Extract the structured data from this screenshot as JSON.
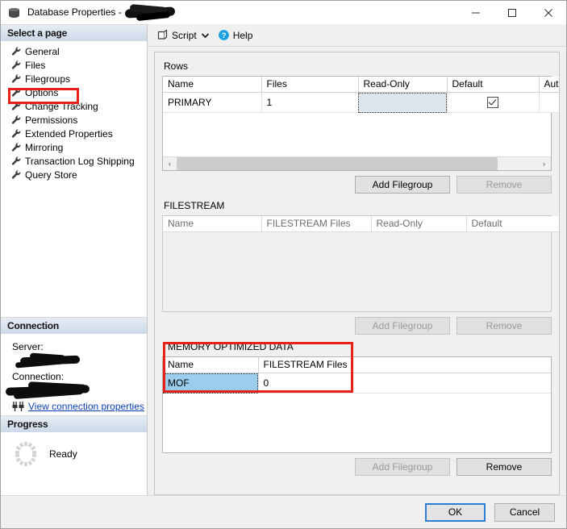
{
  "window": {
    "title_prefix": "Database Properties -",
    "icon": "database-icon",
    "redacted_title": "",
    "controls": {
      "minimize": "—",
      "maximize": "□",
      "close": "✕"
    }
  },
  "sidebar": {
    "select_page_header": "Select a page",
    "items": [
      {
        "label": "General",
        "icon": "wrench-icon",
        "selected": false
      },
      {
        "label": "Files",
        "icon": "wrench-icon",
        "selected": false
      },
      {
        "label": "Filegroups",
        "icon": "wrench-icon",
        "selected": true
      },
      {
        "label": "Options",
        "icon": "wrench-icon",
        "selected": false
      },
      {
        "label": "Change Tracking",
        "icon": "wrench-icon",
        "selected": false
      },
      {
        "label": "Permissions",
        "icon": "wrench-icon",
        "selected": false
      },
      {
        "label": "Extended Properties",
        "icon": "wrench-icon",
        "selected": false
      },
      {
        "label": "Mirroring",
        "icon": "wrench-icon",
        "selected": false
      },
      {
        "label": "Transaction Log Shipping",
        "icon": "wrench-icon",
        "selected": false
      },
      {
        "label": "Query Store",
        "icon": "wrench-icon",
        "selected": false
      }
    ],
    "connection": {
      "header": "Connection",
      "server_label": "Server:",
      "server_value": "",
      "connection_label": "Connection:",
      "connection_value": "",
      "view_properties_link": "View connection properties",
      "link_icon": "connection-plug-icon"
    },
    "progress": {
      "header": "Progress",
      "status": "Ready",
      "spinner_icon": "progress-spinner-icon"
    }
  },
  "toolbar": {
    "script_label": "Script",
    "script_icon": "script-icon",
    "dropdown_icon": "chevron-down-icon",
    "help_label": "Help",
    "help_icon": "help-question-icon"
  },
  "main": {
    "rows_section": {
      "label": "Rows",
      "columns": [
        "Name",
        "Files",
        "Read-Only",
        "Default",
        "Autog"
      ],
      "rows": [
        {
          "name": "PRIMARY",
          "files": "1",
          "read_only": "",
          "default_checked": true,
          "autogrow": ""
        }
      ],
      "add_button": "Add Filegroup",
      "remove_button": "Remove",
      "add_enabled": true,
      "remove_enabled": false,
      "scrollbar": {
        "left_arrow": "‹",
        "right_arrow": "›"
      }
    },
    "filestream_section": {
      "label": "FILESTREAM",
      "columns": [
        "Name",
        "FILESTREAM Files",
        "Read-Only",
        "Default"
      ],
      "rows": [],
      "add_button": "Add Filegroup",
      "remove_button": "Remove",
      "add_enabled": false,
      "remove_enabled": false
    },
    "memory_optimized_section": {
      "label": "MEMORY OPTIMIZED DATA",
      "columns": [
        "Name",
        "FILESTREAM Files"
      ],
      "rows": [
        {
          "name": "MOF",
          "filestream_files": "0",
          "selected": true
        }
      ],
      "add_button": "Add Filegroup",
      "remove_button": "Remove",
      "add_enabled": false,
      "remove_enabled": true
    }
  },
  "footer": {
    "ok_label": "OK",
    "cancel_label": "Cancel"
  },
  "colors": {
    "annotation_red": "#e8201a",
    "selection_blue": "#9dcdee",
    "focus_cell": "#dce6ef",
    "link_blue": "#0b3fb5",
    "default_button_border": "#2a7fd4",
    "section_header": "#ccd9e8"
  }
}
